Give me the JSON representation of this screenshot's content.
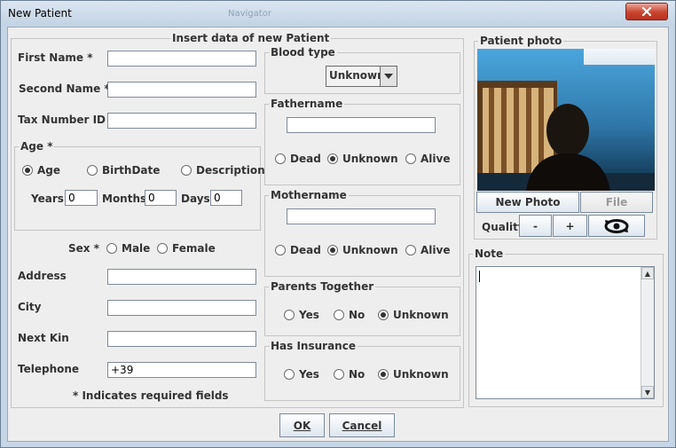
{
  "window": {
    "title": "New Patient",
    "ghost_text": "Navigator"
  },
  "main_panel": {
    "title": "Insert data of new Patient",
    "first_name": {
      "label": "First Name *",
      "value": ""
    },
    "second_name": {
      "label": "Second Name *",
      "value": ""
    },
    "tax_number": {
      "label": "Tax Number ID",
      "value": ""
    },
    "age": {
      "title": "Age *",
      "options": [
        "Age",
        "BirthDate",
        "Description"
      ],
      "selected": "Age",
      "years_label": "Years",
      "years_value": "0",
      "months_label": "Months",
      "months_value": "0",
      "days_label": "Days",
      "days_value": "0"
    },
    "sex": {
      "label": "Sex *",
      "options": [
        "Male",
        "Female"
      ],
      "selected": ""
    },
    "address": {
      "label": "Address",
      "value": ""
    },
    "city": {
      "label": "City",
      "value": ""
    },
    "next_kin": {
      "label": "Next Kin",
      "value": ""
    },
    "telephone": {
      "label": "Telephone",
      "value": "+39"
    },
    "required_note": "* Indicates required fields"
  },
  "blood_type": {
    "title": "Blood type",
    "value": "Unknown"
  },
  "fathername": {
    "title": "Fathername",
    "value": "",
    "options": [
      "Dead",
      "Unknown",
      "Alive"
    ],
    "selected": "Unknown"
  },
  "mothername": {
    "title": "Mothername",
    "value": "",
    "options": [
      "Dead",
      "Unknown",
      "Alive"
    ],
    "selected": "Unknown"
  },
  "parents_together": {
    "title": "Parents Together",
    "options": [
      "Yes",
      "No",
      "Unknown"
    ],
    "selected": "Unknown"
  },
  "has_insurance": {
    "title": "Has Insurance",
    "options": [
      "Yes",
      "No",
      "Unknown"
    ],
    "selected": "Unknown"
  },
  "patient_photo": {
    "title": "Patient photo",
    "new_photo": "New Photo",
    "file": "File",
    "quality_label": "Quality:",
    "minus": "-",
    "plus": "+",
    "camera_icon": "rotate-camera-icon"
  },
  "note": {
    "title": "Note",
    "value": ""
  },
  "footer": {
    "ok": "OK",
    "cancel": "Cancel"
  }
}
